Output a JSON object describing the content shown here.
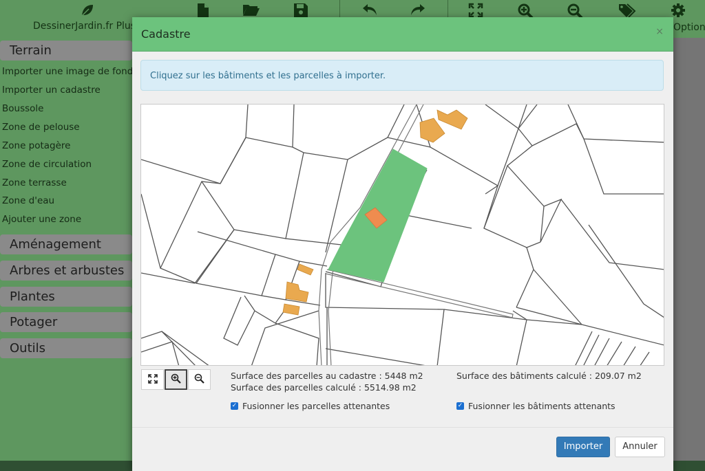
{
  "app": {
    "brand": "DessinerJardin.fr Plus",
    "brand_icon": "leaf-icon",
    "options_label": "Options",
    "toolbar_icons": [
      "new-file-icon",
      "open-folder-icon",
      "save-icon",
      "undo-icon",
      "redo-icon",
      "fit-view-icon",
      "zoom-in-icon",
      "zoom-out-icon",
      "tags-icon",
      "gear-icon"
    ]
  },
  "sidebar": {
    "categories": [
      "Terrain",
      "Aménagement",
      "Arbres et arbustes",
      "Plantes",
      "Potager",
      "Outils"
    ],
    "terrain_items": [
      "Importer une image de fond",
      "Importer un cadastre",
      "Boussole",
      "Zone de pelouse",
      "Zone potagère",
      "Zone de circulation",
      "Zone terrasse",
      "Zone d'eau",
      "Ajouter une zone"
    ]
  },
  "modal": {
    "title": "Cadastre",
    "close_label": "×",
    "info": "Cliquez sur les bâtiments et les parcelles à importer.",
    "map": {
      "selected_parcel_color": "#6cc37d",
      "building_color": "#e9a94f",
      "selected_building_color": "#ef8c4f",
      "line_color": "#555555"
    },
    "zoom_controls": {
      "fit_icon": "fit-view-icon",
      "zoom_in_icon": "zoom-in-icon",
      "zoom_out_icon": "zoom-out-icon",
      "active": "zoom-in"
    },
    "stats": {
      "surface_cadastre": "Surface des parcelles au cadastre : 5448 m2",
      "surface_parcelles": "Surface des parcelles calculé : 5514.98 m2",
      "surface_batiments": "Surface des bâtiments calculé : 209.07 m2"
    },
    "options": {
      "merge_parcels": {
        "label": "Fusionner les parcelles attenantes",
        "checked": true
      },
      "merge_buildings": {
        "label": "Fusionner les bâtiments attenants",
        "checked": true
      }
    },
    "buttons": {
      "import": "Importer",
      "cancel": "Annuler"
    }
  }
}
